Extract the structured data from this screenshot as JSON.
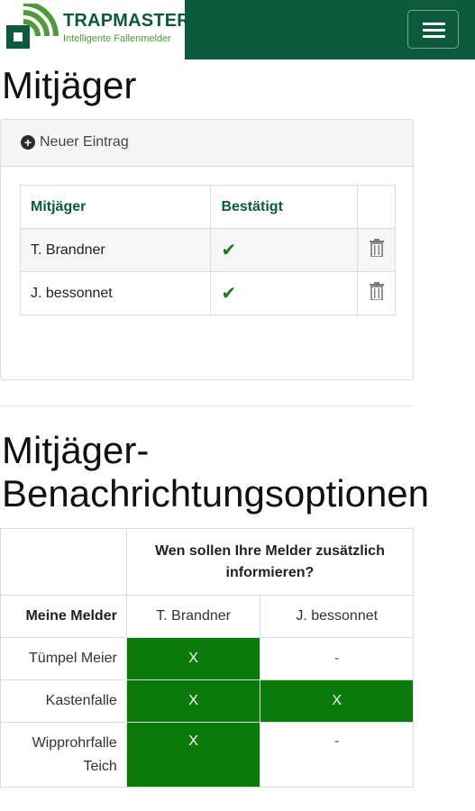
{
  "header": {
    "brand": "TRAPMASTER",
    "tagline": "Intelligente Fallenmelder"
  },
  "colors": {
    "brand_green": "#0c5a3d",
    "active_green": "#0a7a0a"
  },
  "hunters_section": {
    "title": "Mitjäger",
    "new_entry_label": "Neuer Eintrag",
    "columns": [
      "Mitjäger",
      "Bestätigt",
      ""
    ],
    "rows": [
      {
        "name": "T. Brandner",
        "confirmed": "✔",
        "delete_icon": "trash-icon"
      },
      {
        "name": "J. bessonnet",
        "confirmed": "✔",
        "delete_icon": "trash-icon"
      }
    ]
  },
  "notification_section": {
    "title": "Mitjäger-Benachrichtungsoptionen",
    "question": "Wen sollen Ihre Melder zusätzlich informieren?",
    "melder_header": "Meine Melder",
    "hunters": [
      "T. Brandner",
      "J. bessonnet"
    ],
    "rows": [
      {
        "melder": "Tümpel Meier",
        "values": [
          "X",
          "-"
        ]
      },
      {
        "melder": "Kastenfalle",
        "values": [
          "X",
          "X"
        ]
      },
      {
        "melder": "Wipprohrfalle Teich",
        "values": [
          "X",
          "-"
        ]
      }
    ]
  }
}
